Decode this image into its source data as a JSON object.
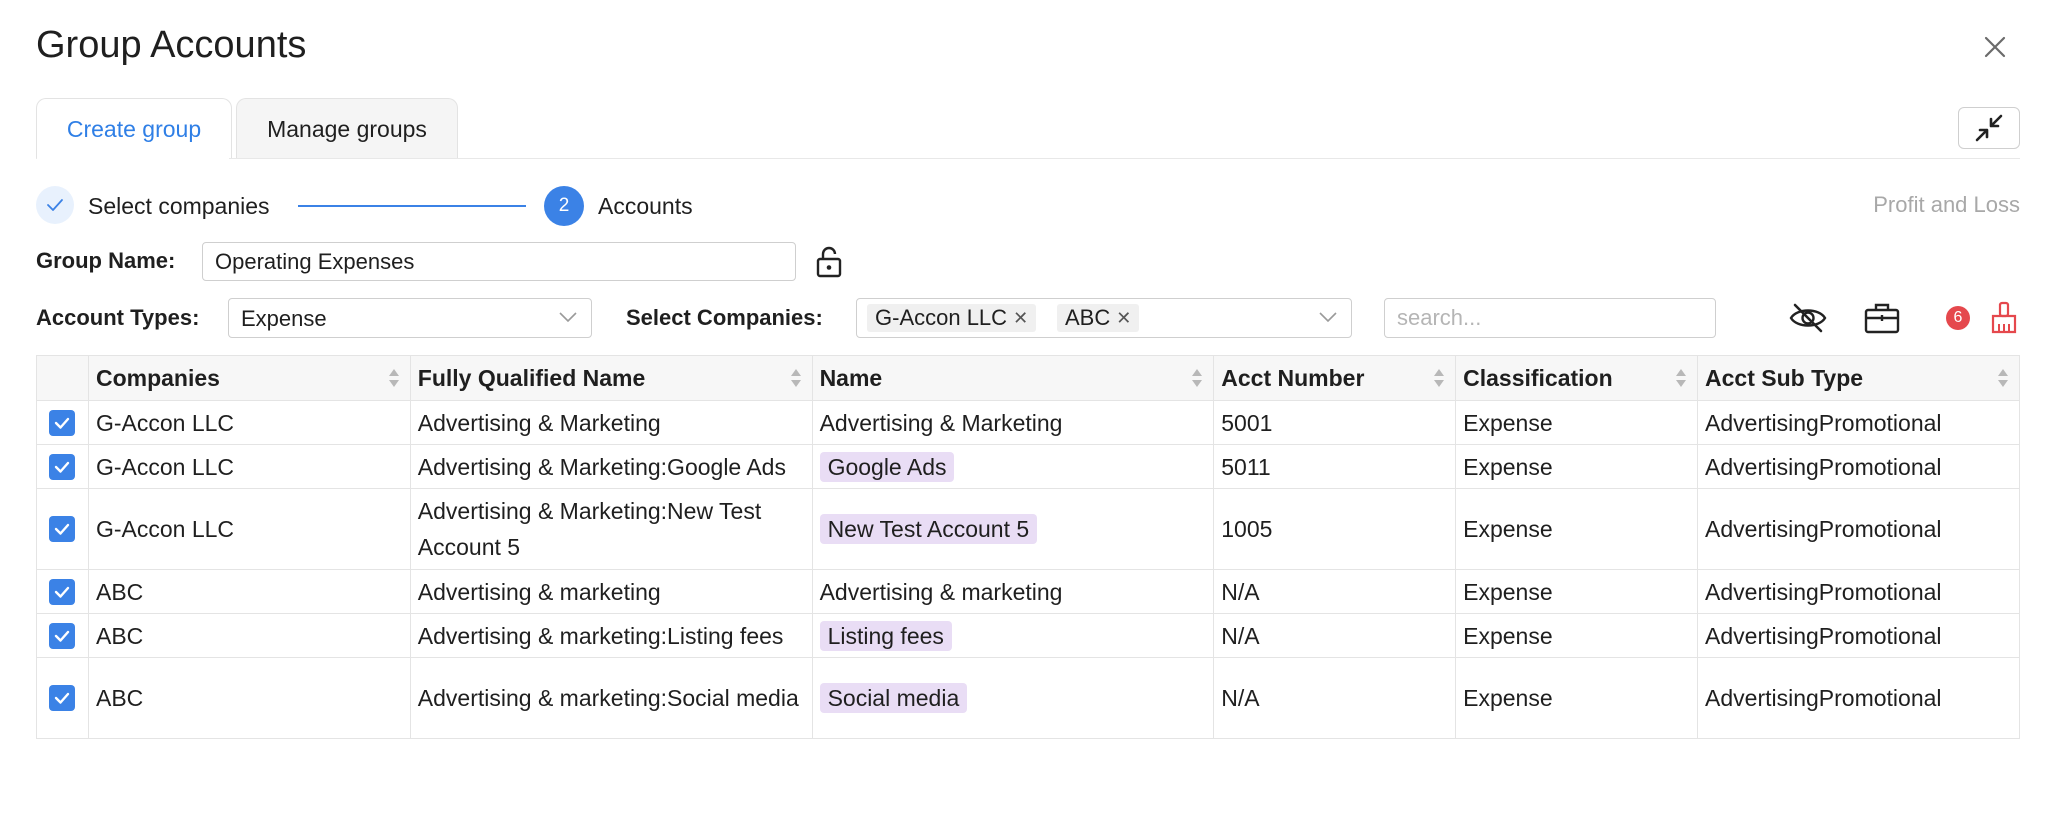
{
  "dialog": {
    "title": "Group Accounts"
  },
  "tabs": [
    {
      "label": "Create group"
    },
    {
      "label": "Manage groups"
    }
  ],
  "steps": {
    "step1_label": "Select companies",
    "step2_number": "2",
    "step2_label": "Accounts"
  },
  "report_type": "Profit and Loss",
  "group_name": {
    "label": "Group Name:",
    "value": "Operating Expenses"
  },
  "account_types": {
    "label": "Account Types:",
    "value": "Expense"
  },
  "select_companies": {
    "label": "Select Companies:",
    "chips": [
      "G-Accon LLC",
      "ABC"
    ]
  },
  "search": {
    "placeholder": "search..."
  },
  "toolbar": {
    "hide_icon": "eye-off-icon",
    "group_icon": "briefcase-icon",
    "count": "6",
    "clear_icon": "broom-icon"
  },
  "colors": {
    "accent": "#3b82e6",
    "tag_bg": "#e9ddf5",
    "badge": "#e5484d",
    "clear_icon": "#e5484d"
  },
  "table": {
    "columns": [
      "Companies",
      "Fully Qualified Name",
      "Name",
      "Acct Number",
      "Classification",
      "Acct Sub Type"
    ],
    "rows": [
      {
        "checked": true,
        "company": "G-Accon LLC",
        "fqn": "Advertising & Marketing",
        "name": "Advertising & Marketing",
        "name_tagged": false,
        "acct_number": "5001",
        "classification": "Expense",
        "sub_type": "AdvertisingPromotional"
      },
      {
        "checked": true,
        "company": "G-Accon LLC",
        "fqn": "Advertising & Marketing:Google Ads",
        "name": "Google Ads",
        "name_tagged": true,
        "acct_number": "5011",
        "classification": "Expense",
        "sub_type": "AdvertisingPromotional"
      },
      {
        "checked": true,
        "company": "G-Accon LLC",
        "fqn": "Advertising & Marketing:New Test Account 5",
        "name": "New Test Account 5",
        "name_tagged": true,
        "acct_number": "1005",
        "classification": "Expense",
        "sub_type": "AdvertisingPromotional"
      },
      {
        "checked": true,
        "company": "ABC",
        "fqn": "Advertising & marketing",
        "name": "Advertising & marketing",
        "name_tagged": false,
        "acct_number": "N/A",
        "classification": "Expense",
        "sub_type": "AdvertisingPromotional"
      },
      {
        "checked": true,
        "company": "ABC",
        "fqn": "Advertising & marketing:Listing fees",
        "name": "Listing fees",
        "name_tagged": true,
        "acct_number": "N/A",
        "classification": "Expense",
        "sub_type": "AdvertisingPromotional"
      },
      {
        "checked": true,
        "company": "ABC",
        "fqn": "Advertising & marketing:Social media",
        "name": "Social media",
        "name_tagged": true,
        "acct_number": "N/A",
        "classification": "Expense",
        "sub_type": "AdvertisingPromotional"
      }
    ]
  }
}
